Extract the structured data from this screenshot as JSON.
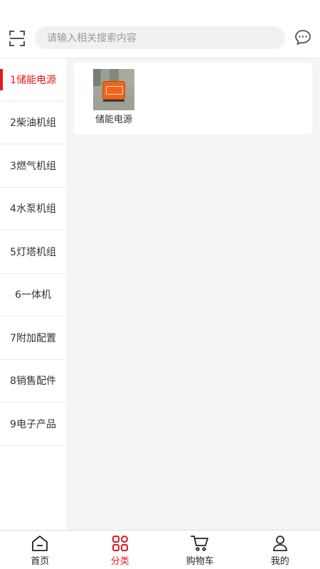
{
  "header": {
    "scan_icon": "scan-icon",
    "search_placeholder": "请输入相关搜索内容",
    "message_icon": "message-icon"
  },
  "sidebar": {
    "items": [
      {
        "label": "1储能电源",
        "active": true
      },
      {
        "label": "2柴油机组"
      },
      {
        "label": "3燃气机组"
      },
      {
        "label": "4水泵机组"
      },
      {
        "label": "5灯塔机组"
      },
      {
        "label": "6一体机"
      },
      {
        "label": "7附加配置"
      },
      {
        "label": "8销售配件"
      },
      {
        "label": "9电子产品"
      }
    ],
    "active_color": "#e6181f"
  },
  "content": {
    "products": [
      {
        "name": "储能电源",
        "image": "orange-power-station-photo"
      }
    ]
  },
  "tabbar": {
    "tabs": [
      {
        "label": "首页",
        "icon": "home-icon"
      },
      {
        "label": "分类",
        "icon": "category-grid-icon",
        "active": true
      },
      {
        "label": "购物车",
        "icon": "cart-icon"
      },
      {
        "label": "我的",
        "icon": "user-icon"
      }
    ]
  }
}
